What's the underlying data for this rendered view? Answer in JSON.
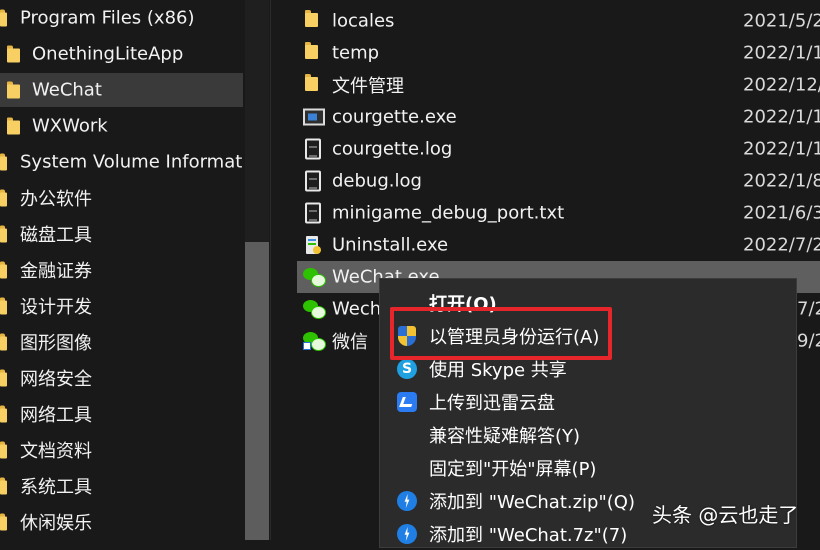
{
  "nav_pane": {
    "items": [
      {
        "label": "Program Files (x86)",
        "selected": false,
        "icon": "folder-icon"
      },
      {
        "label": "OnethingLiteApp",
        "selected": false,
        "icon": "folder-icon"
      },
      {
        "label": "WeChat",
        "selected": true,
        "icon": "folder-icon"
      },
      {
        "label": "WXWork",
        "selected": false,
        "icon": "folder-icon"
      },
      {
        "label": "System Volume Informatic",
        "selected": false,
        "icon": "folder-icon"
      },
      {
        "label": "办公软件",
        "selected": false,
        "icon": "folder-icon"
      },
      {
        "label": "磁盘工具",
        "selected": false,
        "icon": "folder-icon"
      },
      {
        "label": "金融证券",
        "selected": false,
        "icon": "folder-icon"
      },
      {
        "label": "设计开发",
        "selected": false,
        "icon": "folder-icon"
      },
      {
        "label": "图形图像",
        "selected": false,
        "icon": "folder-icon"
      },
      {
        "label": "网络安全",
        "selected": false,
        "icon": "folder-icon"
      },
      {
        "label": "网络工具",
        "selected": false,
        "icon": "folder-icon"
      },
      {
        "label": "文档资料",
        "selected": false,
        "icon": "folder-icon"
      },
      {
        "label": "系统工具",
        "selected": false,
        "icon": "folder-icon"
      },
      {
        "label": "休闲娱乐",
        "selected": false,
        "icon": "folder-icon"
      }
    ]
  },
  "files": [
    {
      "name": "locales",
      "date": "2021/5/2",
      "icon": "folder-icon"
    },
    {
      "name": "temp",
      "date": "2022/1/1",
      "icon": "folder-icon"
    },
    {
      "name": "文件管理",
      "date": "2022/12/",
      "icon": "folder-icon"
    },
    {
      "name": "courgette.exe",
      "date": "2022/1/1",
      "icon": "exe-icon"
    },
    {
      "name": "courgette.log",
      "date": "2022/1/1",
      "icon": "document-icon"
    },
    {
      "name": "debug.log",
      "date": "2022/1/8",
      "icon": "document-icon"
    },
    {
      "name": "minigame_debug_port.txt",
      "date": "2021/6/3",
      "icon": "document-icon"
    },
    {
      "name": "Uninstall.exe",
      "date": "2022/7/2",
      "icon": "uninstall-icon"
    },
    {
      "name": "WeChat.exe",
      "date": "",
      "icon": "wechat-icon"
    },
    {
      "name": "Wech",
      "date": "7/2",
      "icon": "wechat-icon"
    },
    {
      "name": "微信",
      "date": "9/2",
      "icon": "wechat-shortcut-icon"
    }
  ],
  "context_menu": {
    "items": [
      {
        "label": "打开(O)",
        "icon": ""
      },
      {
        "label": "以管理员身份运行(A)",
        "icon": "uac-shield-icon"
      },
      {
        "label": "使用 Skype 共享",
        "icon": "skype-icon"
      },
      {
        "label": "上传到迅雷云盘",
        "icon": "xunlei-icon"
      },
      {
        "label": "兼容性疑难解答(Y)",
        "icon": ""
      },
      {
        "label": "固定到\"开始\"屏幕(P)",
        "icon": ""
      },
      {
        "label": "添加到 \"WeChat.zip\"(Q)",
        "icon": "bandizip-icon"
      },
      {
        "label": "添加到 \"WeChat.7z\"(7)",
        "icon": "bandizip-icon"
      }
    ]
  },
  "watermark": "头条 @云也走了",
  "colors": {
    "background": "#191919",
    "selected_row": "#3a3a3a",
    "menu_background": "#2b2b2b",
    "highlight_border": "#e6262b",
    "folder": "#f7cf63"
  }
}
